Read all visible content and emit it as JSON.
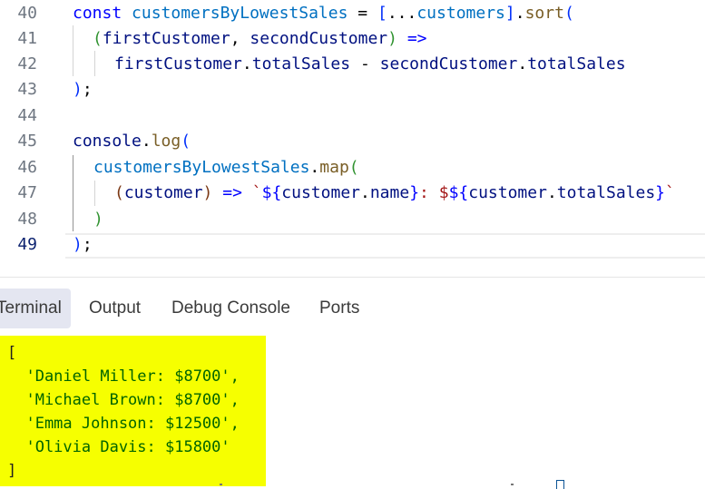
{
  "editor": {
    "line_numbers": [
      "40",
      "41",
      "42",
      "43",
      "44",
      "45",
      "46",
      "47",
      "48",
      "49"
    ],
    "active_line": "49",
    "tokens": {
      "l40": [
        "const",
        "customersByLowestSales",
        "=",
        "[",
        "...",
        "customers",
        "]",
        ".",
        "sort",
        "("
      ],
      "l41": [
        "(",
        "firstCustomer",
        ", ",
        "secondCustomer",
        ")",
        "=>"
      ],
      "l42": [
        "firstCustomer",
        ".",
        "totalSales",
        "-",
        "secondCustomer",
        ".",
        "totalSales"
      ],
      "l43": [
        ")",
        ";"
      ],
      "l45": [
        "console",
        ".",
        "log",
        "("
      ],
      "l46": [
        "customersByLowestSales",
        ".",
        "map",
        "("
      ],
      "l47": [
        "(",
        "customer",
        ")",
        "=>",
        "`",
        "${",
        "customer",
        ".",
        "name",
        "}",
        ": $",
        "${",
        "customer",
        ".",
        "totalSales",
        "}",
        "`"
      ],
      "l48": [
        ")"
      ],
      "l49": [
        ")",
        ";"
      ]
    }
  },
  "panel": {
    "tabs": [
      "Terminal",
      "Output",
      "Debug Console",
      "Ports"
    ],
    "active_tab": "Terminal"
  },
  "terminal": {
    "lines": [
      "[",
      "  'Daniel Miller: $8700',",
      "  'Michael Brown: $8700',",
      "  'Emma Johnson: $12500',",
      "  'Olivia Davis: $15800'",
      "]"
    ],
    "highlight_color": "#f6ff00"
  }
}
